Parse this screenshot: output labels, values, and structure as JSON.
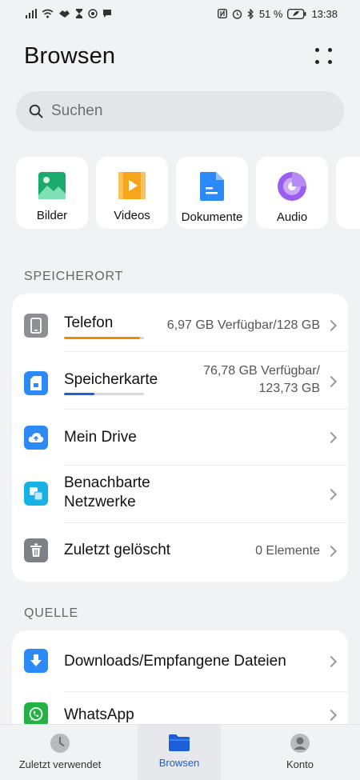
{
  "status": {
    "battery_text": "51 %",
    "time": "13:38"
  },
  "header": {
    "title": "Browsen"
  },
  "search": {
    "placeholder": "Suchen"
  },
  "categories": [
    {
      "label": "Bilder",
      "icon": "image-icon",
      "color": "#1aaa6c"
    },
    {
      "label": "Videos",
      "icon": "video-icon",
      "color": "#f7a51b"
    },
    {
      "label": "Dokumente",
      "icon": "document-icon",
      "color": "#2b8af7"
    },
    {
      "label": "Audio",
      "icon": "audio-icon",
      "color": "#9b5df0"
    }
  ],
  "storage": {
    "label": "SPEICHERORT",
    "items": [
      {
        "title": "Telefon",
        "meta": "6,97 GB Verfügbar/128 GB",
        "used_fraction": 0.95,
        "bar_color": "#f08a00",
        "icon": "phone-icon"
      },
      {
        "title": "Speicherkarte",
        "meta_line1": "76,78 GB Verfügbar/",
        "meta_line2": "123,73 GB",
        "used_fraction": 0.38,
        "bar_color": "#1e5fd8",
        "icon": "sdcard-icon"
      },
      {
        "title": "Mein Drive",
        "icon": "cloud-drive-icon"
      },
      {
        "title_line1": "Benachbarte",
        "title_line2": "Netzwerke",
        "icon": "network-icon"
      },
      {
        "title": "Zuletzt gelöscht",
        "meta": "0 Elemente",
        "icon": "trash-icon"
      }
    ]
  },
  "source": {
    "label": "QUELLE",
    "items": [
      {
        "title": "Downloads/Empfangene Dateien",
        "icon": "download-icon"
      },
      {
        "title": "WhatsApp",
        "icon": "whatsapp-icon"
      }
    ]
  },
  "nav": {
    "recent": "Zuletzt verwendet",
    "browse": "Browsen",
    "account": "Konto"
  },
  "colors": {
    "accent": "#1b5ed8",
    "background": "#f1f2f4"
  }
}
